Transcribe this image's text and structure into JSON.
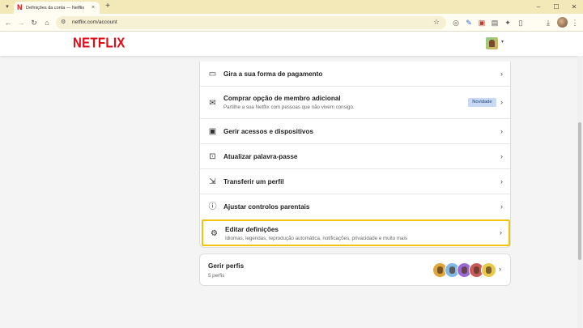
{
  "browser": {
    "tab_title": "Definições da conta — Netflix",
    "tab_close": "×",
    "new_tab": "+",
    "url": "netflix.com/account",
    "controls": {
      "minimize": "–",
      "maximize": "☐",
      "close": "✕"
    }
  },
  "header": {
    "logo": "NETFLIX",
    "caret": "▾"
  },
  "settings": {
    "items": [
      {
        "label": "Gira a sua forma de pagamento",
        "icon": "card-icon"
      },
      {
        "label": "Comprar opção de membro adicional",
        "sub": "Partilhe a sua Netflix com pessoas que não vivem consigo.",
        "badge": "Novidade",
        "icon": "envelope-icon"
      },
      {
        "label": "Gerir acessos e dispositivos",
        "icon": "devices-icon"
      },
      {
        "label": "Atualizar palavra-passe",
        "icon": "lock-icon"
      },
      {
        "label": "Transferir um perfil",
        "icon": "transfer-icon"
      },
      {
        "label": "Ajustar controlos parentais",
        "icon": "alert-icon"
      },
      {
        "label": "Editar definições",
        "sub": "Idiomas, legendas, reprodução automática, notificações, privacidade e muito mais",
        "icon": "gear-icon"
      }
    ]
  },
  "profiles": {
    "title": "Gerir perfis",
    "count": "5 perfis",
    "avatar_colors": [
      "#e0a63a",
      "#7fb8e6",
      "#9a6bd6",
      "#c85b5b",
      "#e9c94a"
    ]
  },
  "colors": {
    "netflix_red": "#e50914",
    "highlight": "#f2c40e",
    "badge_bg": "#c7d9f5"
  }
}
